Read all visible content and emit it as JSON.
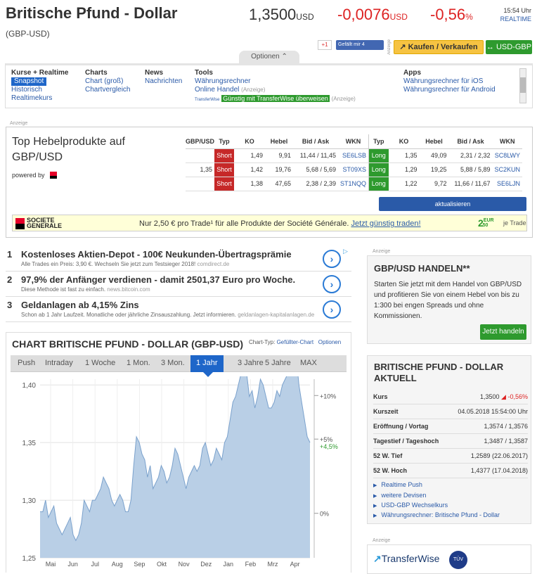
{
  "header": {
    "title": "Britische Pfund - Dollar",
    "subtitle": "(GBP-USD)",
    "price": "1,3500",
    "price_unit": "USD",
    "change": "-0,0076",
    "change_unit": "USD",
    "pct": "-0,56",
    "pct_unit": "%",
    "time": "15:54 Uhr",
    "realtime": "REALTIME",
    "gplus": "+1",
    "fb": "Gefällt mir 4",
    "anzeige": "Anzeige",
    "kaufen_btn": "Kaufen / Verkaufen",
    "usd_btn": "USD-GBP",
    "options_tab": "Optionen"
  },
  "nav": {
    "col1": {
      "head": "Kurse + Realtime",
      "items": [
        "Snapshot",
        "Historisch",
        "Realtimekurs"
      ]
    },
    "col2": {
      "head": "Charts",
      "items": [
        "Chart (groß)",
        "Chartvergleich"
      ]
    },
    "col3": {
      "head": "News",
      "items": [
        "Nachrichten"
      ]
    },
    "col4": {
      "head": "Tools",
      "items": [
        "Währungsrechner",
        "Online Handel"
      ],
      "ad": "(Anzeige)",
      "tw_text": "TransferWise",
      "tw_badge": "Günstig mit TransferWise überweisen",
      "tw_ad": "(Anzeige)"
    },
    "col5": {
      "head": "Apps",
      "items": [
        "Währungsrechner für iOS",
        "Währungsrechner für Android"
      ]
    }
  },
  "hebel": {
    "anzeige": "Anzeige",
    "title": "Top Hebelprodukte auf GBP/USD",
    "powered": "powered by",
    "headers": [
      "GBP/USD",
      "Typ",
      "KO",
      "Hebel",
      "Bid / Ask",
      "WKN",
      "Typ",
      "KO",
      "Hebel",
      "Bid / Ask",
      "WKN"
    ],
    "rows": [
      {
        "gbp": "",
        "typ1": "Short",
        "ko1": "1,49",
        "h1": "9,91",
        "ba1": "11,44 / 11,45",
        "wkn1": "SE6LSB",
        "typ2": "Long",
        "ko2": "1,35",
        "h2": "49,09",
        "ba2": "2,31 / 2,32",
        "wkn2": "SC8LWY"
      },
      {
        "gbp": "1,35",
        "typ1": "Short",
        "ko1": "1,42",
        "h1": "19,76",
        "ba1": "5,68 / 5,69",
        "wkn1": "ST09XS",
        "typ2": "Long",
        "ko2": "1,29",
        "h2": "19,25",
        "ba2": "5,88 / 5,89",
        "wkn2": "SC2KUN"
      },
      {
        "gbp": "",
        "typ1": "Short",
        "ko1": "1,38",
        "h1": "47,65",
        "ba1": "2,38 / 2,39",
        "wkn1": "ST1NQQ",
        "typ2": "Long",
        "ko2": "1,22",
        "h2": "9,72",
        "ba2": "11,66 / 11,67",
        "wkn2": "SE6LJN"
      }
    ],
    "update_btn": "aktualisieren",
    "sg_logo1": "SOCIETE",
    "sg_logo2": "GENERALE",
    "sg_text": "Nur 2,50 € pro Trade¹ für alle Produkte der Société Générale.",
    "sg_link": "Jetzt günstig traden!",
    "sg_price": "2",
    "sg_cents": "50",
    "sg_eur": "EUR",
    "sg_je": "je Trade"
  },
  "ads": [
    {
      "n": "1",
      "title": "Kostenloses Aktien-Depot - 100€ Neukunden-Übertragsprämie",
      "desc": "Alle Trades ein Preis: 3,90 €. Wechseln Sie jetzt zum Testsieger 2018!",
      "src": "comdirect.de"
    },
    {
      "n": "2",
      "title": "97,9% der Anfänger verdienen - damit 2501,37 Euro pro Woche.",
      "desc": "Diese Methode ist fast zu einfach.",
      "src": "news.bitcoin.com"
    },
    {
      "n": "3",
      "title": "Geldanlagen ab 4,15% Zins",
      "desc": "Schon ab 1 Jahr Laufzeit. Monatliche oder jährliche Zinsauszahlung. Jetzt informieren.",
      "src": "geldanlagen-kapitalanlagen.de"
    }
  ],
  "chart": {
    "title": "CHART BRITISCHE PFUND - DOLLAR (GBP-USD)",
    "type_label": "Chart-Typ:",
    "type_value": "Gefüllter-Chart",
    "options": "Optionen",
    "ranges": [
      "Push",
      "Intraday",
      "1 Woche",
      "1 Mon.",
      "3 Mon.",
      "1 Jahr",
      "3 Jahre",
      "5 Jahre",
      "MAX"
    ],
    "active_range": "1 Jahr"
  },
  "chart_data": {
    "type": "area",
    "x_ticks": [
      "Mai",
      "Jun",
      "Jul",
      "Aug",
      "Sep",
      "Okt",
      "Nov",
      "Dez",
      "Jan",
      "Feb",
      "Mrz",
      "Apr"
    ],
    "y_ticks": [
      "1,40",
      "1,35",
      "1,30",
      "1,25"
    ],
    "ylim": [
      1.25,
      1.405
    ],
    "right_ticks": [
      "+10%",
      "+5%",
      "0%"
    ],
    "current_pct": "+4,5%",
    "values": [
      1.29,
      1.29,
      1.3,
      1.285,
      1.29,
      1.295,
      1.28,
      1.275,
      1.27,
      1.275,
      1.28,
      1.285,
      1.27,
      1.265,
      1.27,
      1.28,
      1.3,
      1.295,
      1.29,
      1.3,
      1.3,
      1.305,
      1.31,
      1.32,
      1.315,
      1.31,
      1.3,
      1.295,
      1.3,
      1.305,
      1.3,
      1.29,
      1.29,
      1.3,
      1.33,
      1.355,
      1.35,
      1.34,
      1.335,
      1.32,
      1.33,
      1.31,
      1.315,
      1.32,
      1.33,
      1.325,
      1.315,
      1.32,
      1.33,
      1.345,
      1.34,
      1.33,
      1.32,
      1.31,
      1.32,
      1.325,
      1.33,
      1.325,
      1.33,
      1.345,
      1.35,
      1.34,
      1.33,
      1.335,
      1.345,
      1.34,
      1.335,
      1.35,
      1.355,
      1.37,
      1.385,
      1.39,
      1.4,
      1.41,
      1.42,
      1.41,
      1.39,
      1.395,
      1.38,
      1.39,
      1.405,
      1.4,
      1.39,
      1.38,
      1.38,
      1.385,
      1.395,
      1.39,
      1.4,
      1.405,
      1.41,
      1.42,
      1.43,
      1.425,
      1.4,
      1.385,
      1.37,
      1.355,
      1.35
    ],
    "line_color": "#7aa1cc",
    "fill_color": "#b9cfe6"
  },
  "handeln": {
    "anzeige": "Anzeige",
    "title": "GBP/USD HANDELN**",
    "text": "Starten Sie jetzt mit dem Handel von GBP/USD und profitieren Sie von einem Hebel von bis zu 1:300 bei engen Spreads und ohne Kommissionen.",
    "btn": "Jetzt handeln"
  },
  "aktuell": {
    "title": "BRITISCHE PFUND - DOLLAR AKTUELL",
    "rows": [
      {
        "label": "Kurs",
        "value": "1,3500",
        "extra": "-0,56%"
      },
      {
        "label": "Kurszeit",
        "value": "04.05.2018 15:54:00 Uhr"
      },
      {
        "label": "Eröffnung / Vortag",
        "value": "1,3574 / 1,3576"
      },
      {
        "label": "Tagestief / Tageshoch",
        "value": "1,3487 / 1,3587"
      },
      {
        "label": "52 W. Tief",
        "value": "1,2589 (22.06.2017)"
      },
      {
        "label": "52 W. Hoch",
        "value": "1,4377 (17.04.2018)"
      }
    ],
    "links": [
      "Realtime Push",
      "weitere Devisen",
      "USD-GBP Wechselkurs",
      "Währungsrechner: Britische Pfund - Dollar"
    ]
  },
  "twbox": {
    "anzeige": "Anzeige",
    "logo": "TransferWise",
    "tuv": "TÜV"
  }
}
